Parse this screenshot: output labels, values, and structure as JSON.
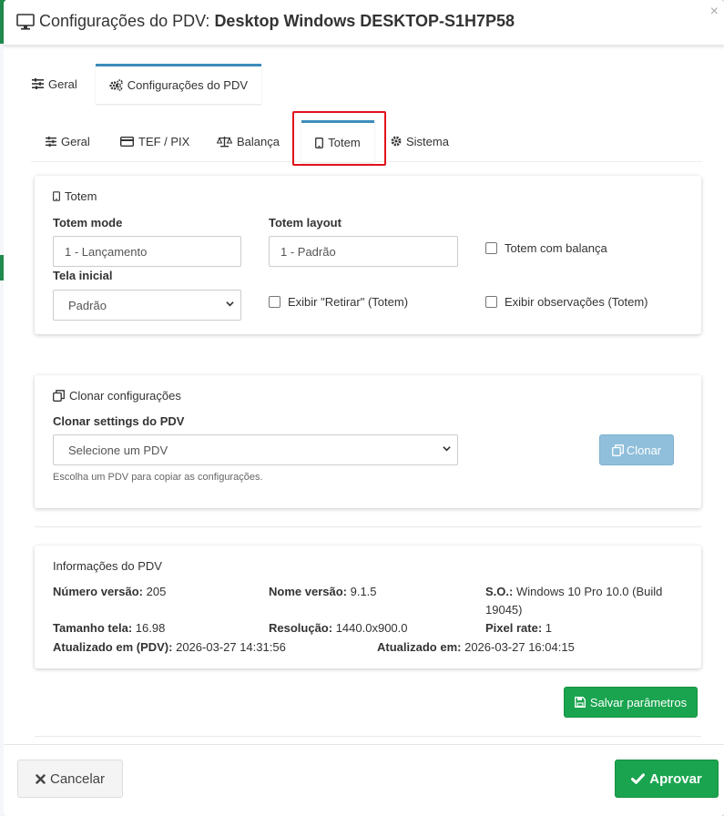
{
  "window": {
    "title_prefix": "Configurações do PDV:",
    "title_device": "Desktop Windows DESKTOP-S1H7P58",
    "close_glyph": "×"
  },
  "tabs_top": [
    {
      "label": "Geral",
      "icon": "sliders-icon"
    },
    {
      "label": "Configurações do PDV",
      "icon": "gears-icon",
      "active": true
    }
  ],
  "tabs_sub": [
    {
      "label": "Geral",
      "icon": "sliders-icon"
    },
    {
      "label": "TEF / PIX",
      "icon": "credit-card-icon"
    },
    {
      "label": "Balança",
      "icon": "scale-icon"
    },
    {
      "label": "Totem",
      "icon": "tablet-icon",
      "active": true
    },
    {
      "label": "Sistema",
      "icon": "gear-icon"
    }
  ],
  "totem": {
    "title": "Totem",
    "mode_label": "Totem mode",
    "mode_value": "1 - Lançamento",
    "layout_label": "Totem layout",
    "layout_value": "1 - Padrão",
    "com_balanca_label": "Totem com balança",
    "tela_inicial_label": "Tela inicial",
    "tela_inicial_value": "Padrão",
    "exibir_retirar_label": "Exibir \"Retirar\" (Totem)",
    "exibir_obs_label": "Exibir observações (Totem)"
  },
  "clone": {
    "title": "Clonar configurações",
    "settings_label": "Clonar settings do PDV",
    "select_placeholder": "Selecione um PDV",
    "hint": "Escolha um PDV para copiar as configurações.",
    "button_label": "Clonar"
  },
  "info": {
    "title": "Informações do PDV",
    "numero_versao_label": "Número versão:",
    "numero_versao_value": "205",
    "nome_versao_label": "Nome versão:",
    "nome_versao_value": "9.1.5",
    "so_label": "S.O.:",
    "so_value_line1": "Windows 10 Pro 10.0 (Build",
    "so_value_line2": "19045)",
    "tamanho_tela_label": "Tamanho tela:",
    "tamanho_tela_value": "16.98",
    "resolucao_label": "Resolução:",
    "resolucao_value": "1440.0x900.0",
    "pixel_rate_label": "Pixel rate:",
    "pixel_rate_value": "1",
    "atualizado_pdv_label": "Atualizado em (PDV):",
    "atualizado_pdv_value": "2026-03-27 14:31:56",
    "atualizado_label": "Atualizado em:",
    "atualizado_value": "2026-03-27 16:04:15"
  },
  "actions": {
    "save_label": "Salvar parâmetros",
    "cancel_label": "Cancelar",
    "approve_label": "Aprovar"
  },
  "colors": {
    "tab_accent": "#3c8dbc",
    "highlight": "#e0131b",
    "success": "#1aa44f",
    "clone_button": "#8fbfdb"
  }
}
